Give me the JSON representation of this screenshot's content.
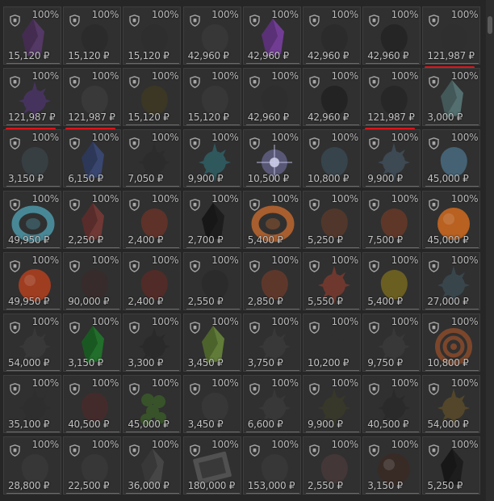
{
  "grid": {
    "columns": 8,
    "items": [
      {
        "condition": "100%",
        "price": "15,120 ₽",
        "color": "#5a3a6e",
        "shape": "crystal"
      },
      {
        "condition": "100%",
        "price": "15,120 ₽",
        "color": "#2a2a2a",
        "shape": "blob"
      },
      {
        "condition": "100%",
        "price": "15,120 ₽",
        "color": "#2e2e2e",
        "shape": "blob"
      },
      {
        "condition": "100%",
        "price": "42,960 ₽",
        "color": "#3a3a3a",
        "shape": "blob"
      },
      {
        "condition": "100%",
        "price": "42,960 ₽",
        "color": "#7c3fa6",
        "shape": "crystal"
      },
      {
        "condition": "100%",
        "price": "42,960 ₽",
        "color": "#2b2b2b",
        "shape": "blob"
      },
      {
        "condition": "100%",
        "price": "42,960 ₽",
        "color": "#232323",
        "shape": "blob"
      },
      {
        "condition": "100%",
        "price": "121,987 ₽",
        "color": "#2f2f2f",
        "shape": "blob"
      },
      {
        "condition": "100%",
        "price": "121,987 ₽",
        "color": "#4a3466",
        "shape": "spiky"
      },
      {
        "condition": "100%",
        "price": "121,987 ₽",
        "color": "#3c3c3c",
        "shape": "blob"
      },
      {
        "condition": "100%",
        "price": "15,120 ₽",
        "color": "#3e3a22",
        "shape": "blob"
      },
      {
        "condition": "100%",
        "price": "15,120 ₽",
        "color": "#3a3a3a",
        "shape": "blob"
      },
      {
        "condition": "100%",
        "price": "42,960 ₽",
        "color": "#2e2e2e",
        "shape": "blob"
      },
      {
        "condition": "100%",
        "price": "42,960 ₽",
        "color": "#202020",
        "shape": "blob"
      },
      {
        "condition": "100%",
        "price": "121,987 ₽",
        "color": "#262626",
        "shape": "blob"
      },
      {
        "condition": "100%",
        "price": "3,000 ₽",
        "color": "#5a7a7a",
        "shape": "crystal"
      },
      {
        "condition": "100%",
        "price": "3,150 ₽",
        "color": "#3a4448",
        "shape": "blob"
      },
      {
        "condition": "100%",
        "price": "6,150 ₽",
        "color": "#3b4a7a",
        "shape": "crystal"
      },
      {
        "condition": "100%",
        "price": "7,050 ₽",
        "color": "#2c2c2c",
        "shape": "spiky"
      },
      {
        "condition": "100%",
        "price": "9,900 ₽",
        "color": "#2f5f66",
        "shape": "spiky"
      },
      {
        "condition": "100%",
        "price": "10,500 ₽",
        "color": "#7a7ab0",
        "shape": "star"
      },
      {
        "condition": "100%",
        "price": "10,800 ₽",
        "color": "#3a4a52",
        "shape": "blob"
      },
      {
        "condition": "100%",
        "price": "9,900 ₽",
        "color": "#404e5a",
        "shape": "spiky"
      },
      {
        "condition": "100%",
        "price": "45,000 ₽",
        "color": "#4a6f86",
        "shape": "blob"
      },
      {
        "condition": "100%",
        "price": "49,950 ₽",
        "color": "#4f9fb0",
        "shape": "ring"
      },
      {
        "condition": "100%",
        "price": "2,250 ₽",
        "color": "#7a3a36",
        "shape": "crystal"
      },
      {
        "condition": "100%",
        "price": "2,400 ₽",
        "color": "#6a3328",
        "shape": "blob"
      },
      {
        "condition": "100%",
        "price": "2,700 ₽",
        "color": "#1a1a1a",
        "shape": "crystal"
      },
      {
        "condition": "100%",
        "price": "5,400 ₽",
        "color": "#c76a2e",
        "shape": "ring"
      },
      {
        "condition": "100%",
        "price": "5,250 ₽",
        "color": "#5a3a2a",
        "shape": "blob"
      },
      {
        "condition": "100%",
        "price": "7,500 ₽",
        "color": "#6a3a28",
        "shape": "blob"
      },
      {
        "condition": "100%",
        "price": "45,000 ₽",
        "color": "#d06a1e",
        "shape": "orb"
      },
      {
        "condition": "100%",
        "price": "49,950 ₽",
        "color": "#b3401e",
        "shape": "orb"
      },
      {
        "condition": "100%",
        "price": "90,000 ₽",
        "color": "#3a2a2a",
        "shape": "blob"
      },
      {
        "condition": "100%",
        "price": "2,400 ₽",
        "color": "#5a2a26",
        "shape": "blob"
      },
      {
        "condition": "100%",
        "price": "2,550 ₽",
        "color": "#2a2a2a",
        "shape": "blob"
      },
      {
        "condition": "100%",
        "price": "2,850 ₽",
        "color": "#6a3a2a",
        "shape": "blob"
      },
      {
        "condition": "100%",
        "price": "5,550 ₽",
        "color": "#7a3a2e",
        "shape": "spiky"
      },
      {
        "condition": "100%",
        "price": "5,400 ₽",
        "color": "#7a6a1e",
        "shape": "blob"
      },
      {
        "condition": "100%",
        "price": "27,000 ₽",
        "color": "#3a4a52",
        "shape": "spiky"
      },
      {
        "condition": "100%",
        "price": "54,000 ₽",
        "color": "#3a3a3a",
        "shape": "spiky"
      },
      {
        "condition": "100%",
        "price": "3,150 ₽",
        "color": "#1f7a2a",
        "shape": "crystal"
      },
      {
        "condition": "100%",
        "price": "3,300 ₽",
        "color": "#2a2a2a",
        "shape": "spiky"
      },
      {
        "condition": "100%",
        "price": "3,450 ₽",
        "color": "#6a8a3a",
        "shape": "crystal"
      },
      {
        "condition": "100%",
        "price": "3,750 ₽",
        "color": "#3a3a3a",
        "shape": "spiky"
      },
      {
        "condition": "100%",
        "price": "10,200 ₽",
        "color": "#303030",
        "shape": "spiky"
      },
      {
        "condition": "100%",
        "price": "9,750 ₽",
        "color": "#3a3a3a",
        "shape": "spiky"
      },
      {
        "condition": "100%",
        "price": "10,800 ₽",
        "color": "#8a4a2a",
        "shape": "swirl"
      },
      {
        "condition": "100%",
        "price": "35,100 ₽",
        "color": "#2e2e2e",
        "shape": "spiky"
      },
      {
        "condition": "100%",
        "price": "40,500 ₽",
        "color": "#4a2a2a",
        "shape": "blob"
      },
      {
        "condition": "100%",
        "price": "45,000 ₽",
        "color": "#3a5a2a",
        "shape": "cluster"
      },
      {
        "condition": "100%",
        "price": "3,450 ₽",
        "color": "#3a3a3a",
        "shape": "blob"
      },
      {
        "condition": "100%",
        "price": "6,600 ₽",
        "color": "#3a3a3a",
        "shape": "spiky"
      },
      {
        "condition": "100%",
        "price": "9,900 ₽",
        "color": "#3a3a2a",
        "shape": "spiky"
      },
      {
        "condition": "100%",
        "price": "40,500 ₽",
        "color": "#2a2a2a",
        "shape": "spiky"
      },
      {
        "condition": "100%",
        "price": "54,000 ₽",
        "color": "#5a4a2a",
        "shape": "spiky"
      },
      {
        "condition": "100%",
        "price": "28,800 ₽",
        "color": "#3a3a3a",
        "shape": "blob"
      },
      {
        "condition": "100%",
        "price": "22,500 ₽",
        "color": "#3a3a3a",
        "shape": "blob"
      },
      {
        "condition": "100%",
        "price": "36,000 ₽",
        "color": "#4a4a4a",
        "shape": "crystal"
      },
      {
        "condition": "100%",
        "price": "180,000 ₽",
        "color": "#5a5a5a",
        "shape": "card"
      },
      {
        "condition": "100%",
        "price": "153,000 ₽",
        "color": "#3a3a3a",
        "shape": "blob"
      },
      {
        "condition": "100%",
        "price": "2,550 ₽",
        "color": "#4a3a3a",
        "shape": "blob"
      },
      {
        "condition": "100%",
        "price": "3,150 ₽",
        "color": "#3a2a24",
        "shape": "orb"
      },
      {
        "condition": "100%",
        "price": "5,250 ₽",
        "color": "#1a1a1a",
        "shape": "crystal"
      }
    ],
    "highlighted": [
      7,
      8,
      9,
      14
    ]
  },
  "colors": {
    "highlight": "#d8161b",
    "background": "#262626",
    "tile": "#303030"
  },
  "icons": {
    "condition": "shield-icon"
  }
}
